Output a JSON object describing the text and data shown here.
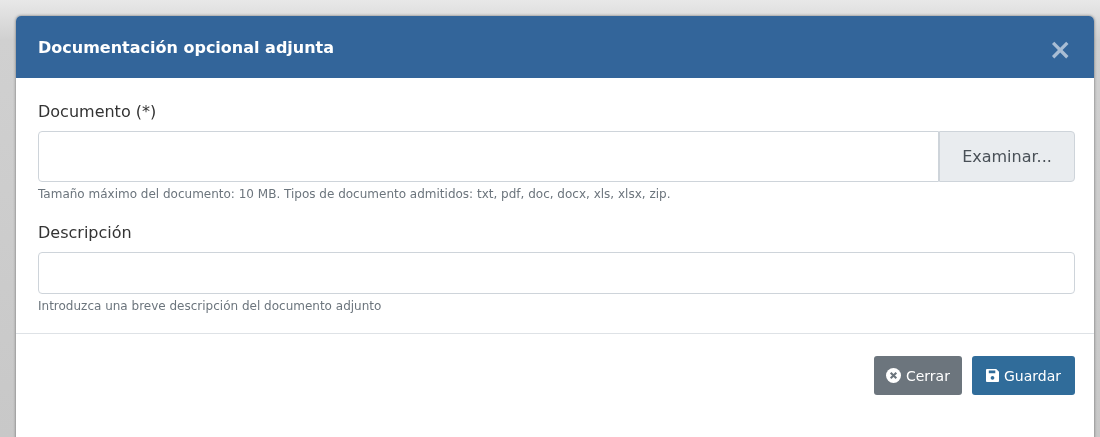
{
  "dialog": {
    "title": "Documentación opcional adjunta",
    "close": "×"
  },
  "fields": [
    {
      "label": "Documento (*)",
      "kind": "file",
      "button": "Examinar...",
      "help": "Tamaño máximo del documento: 10 MB. Tipos de documento admitidos: txt, pdf, doc, docx, xls, xlsx, zip."
    },
    {
      "label": "Descripción",
      "kind": "text",
      "help": "Introduzca una breve descripción del documento adjunto"
    }
  ],
  "buttons": [
    {
      "label": "Cerrar",
      "kind": "close"
    },
    {
      "label": "Guardar",
      "kind": "save"
    }
  ]
}
